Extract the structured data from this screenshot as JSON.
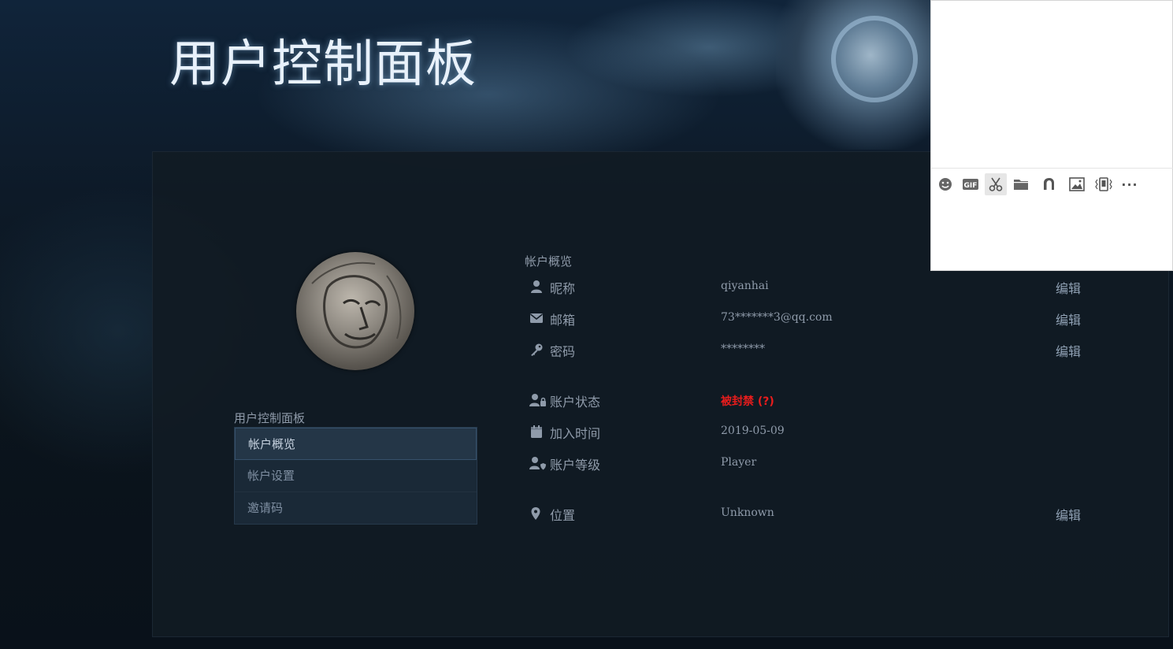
{
  "page": {
    "title": "用户控制面板"
  },
  "sidebar": {
    "heading": "用户控制面板",
    "items": [
      {
        "label": "帐户概览",
        "active": true
      },
      {
        "label": "帐户设置",
        "active": false
      },
      {
        "label": "邀请码",
        "active": false
      }
    ]
  },
  "overview": {
    "section_title": "帐户概览",
    "rows": [
      {
        "icon": "user-icon",
        "label": "昵称",
        "value": "qiyanhai",
        "edit": "编辑"
      },
      {
        "icon": "envelope-icon",
        "label": "邮箱",
        "value": "73*******3@qq.com",
        "edit": "编辑"
      },
      {
        "icon": "key-icon",
        "label": "密码",
        "value": "********",
        "edit": "编辑"
      },
      {
        "icon": "user-lock-icon",
        "label": "账户状态",
        "value": "被封禁 (?)",
        "status_color": "#e81c1c"
      },
      {
        "icon": "calendar-icon",
        "label": "加入时间",
        "value": "2019-05-09"
      },
      {
        "icon": "user-shield-icon",
        "label": "账户等级",
        "value": "Player"
      },
      {
        "icon": "map-marker-icon",
        "label": "位置",
        "value": "Unknown",
        "edit": "编辑"
      }
    ]
  },
  "chat_toolbar": {
    "tools": [
      "emoji-icon",
      "gif-icon",
      "scissors-icon",
      "folder-icon",
      "music-icon",
      "image-icon",
      "shake-icon",
      "more-icon"
    ],
    "gif_label": "GIF",
    "more_label": "···"
  },
  "colors": {
    "background": "#0b141c",
    "panel": "#111b24",
    "text": "#8f9baa",
    "banned": "#e81c1c",
    "title": "#e8f1fb"
  }
}
